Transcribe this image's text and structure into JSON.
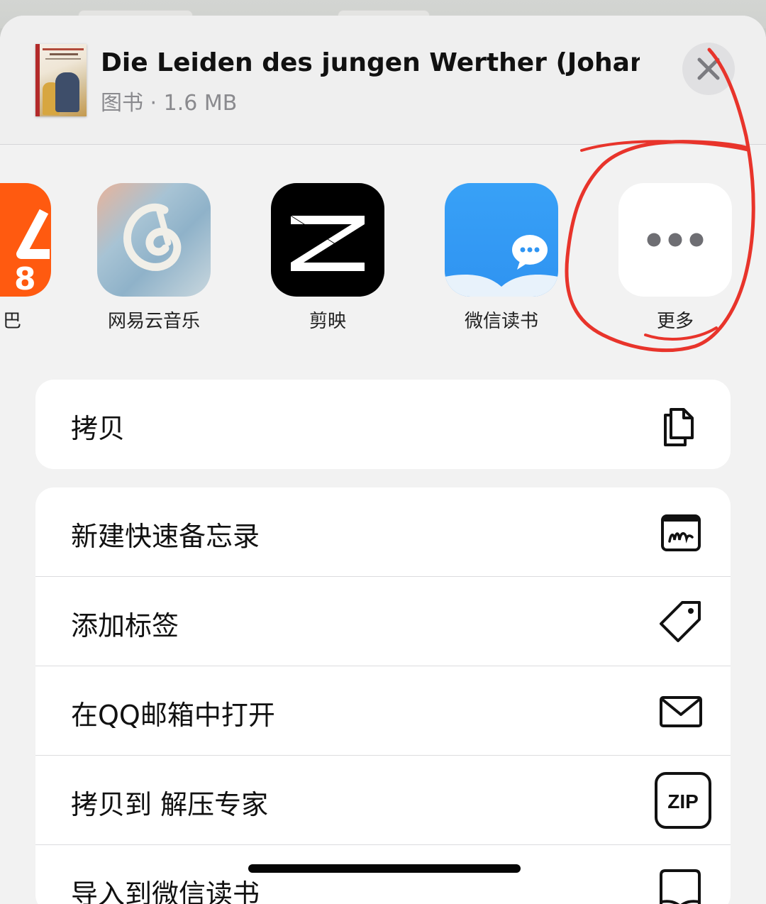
{
  "header": {
    "book_title": "Die Leiden des jungen Werther (Johann...",
    "book_meta": "图书 · 1.6 MB"
  },
  "apps": [
    {
      "label": "巴",
      "icon": "taobao-app-icon"
    },
    {
      "label": "网易云音乐",
      "icon": "netease-music-app-icon"
    },
    {
      "label": "剪映",
      "icon": "capcut-app-icon"
    },
    {
      "label": "微信读书",
      "icon": "weread-app-icon"
    },
    {
      "label": "更多",
      "icon": "more-dots-icon"
    }
  ],
  "actions_group1": [
    {
      "label": "拷贝",
      "icon": "copy-icon"
    }
  ],
  "actions_group2": [
    {
      "label": "新建快速备忘录",
      "icon": "quick-note-icon"
    },
    {
      "label": "添加标签",
      "icon": "tag-icon"
    },
    {
      "label": "在QQ邮箱中打开",
      "icon": "mail-icon"
    },
    {
      "label": "拷贝到 解压专家",
      "icon": "zip-icon"
    },
    {
      "label": "导入到微信读书",
      "icon": "book-icon"
    }
  ],
  "zip_icon_text": "ZIP",
  "colors": {
    "annotation_red": "#e8342b",
    "weread_blue": "#2f95f3",
    "taobao_orange": "#ff5a10"
  }
}
